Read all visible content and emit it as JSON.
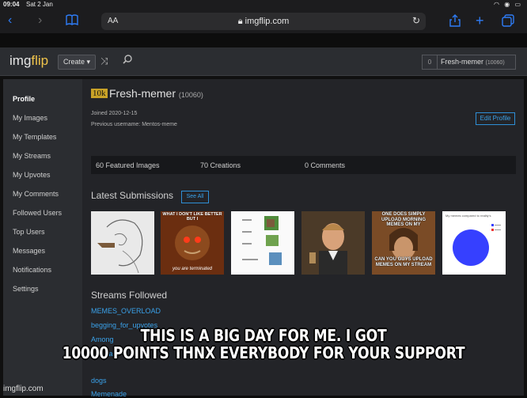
{
  "status_bar": {
    "time": "09:04",
    "date": "Sat 2 Jan",
    "icons": "wifi-icon battery-icon"
  },
  "browser": {
    "text_size_label": "AA",
    "url": "imgflip.com"
  },
  "header": {
    "logo_main": "img",
    "logo_accent": "flip",
    "create_label": "Create ▾",
    "user_points_badge": "0",
    "user_name": "Fresh-memer",
    "user_points": "(10060)"
  },
  "sidebar": {
    "items": [
      {
        "label": "Profile"
      },
      {
        "label": "My Images"
      },
      {
        "label": "My Templates"
      },
      {
        "label": "My Streams"
      },
      {
        "label": "My Upvotes"
      },
      {
        "label": "My Comments"
      },
      {
        "label": "Followed Users"
      },
      {
        "label": "Top Users"
      },
      {
        "label": "Messages"
      },
      {
        "label": "Notifications"
      },
      {
        "label": "Settings"
      }
    ]
  },
  "profile": {
    "rank_badge": "10k",
    "username": "Fresh-memer",
    "points": "(10060)",
    "joined": "Joined 2020-12-15",
    "previous_username": "Previous username: Mentos-meme",
    "edit_label": "Edit Profile",
    "stats": [
      "60 Featured Images",
      "70 Creations",
      "0 Comments"
    ]
  },
  "latest": {
    "title": "Latest Submissions",
    "see_all": "See All",
    "thumbs": [
      {
        "name": "sketch-meme"
      },
      {
        "name": "terminated-meme",
        "top": "WHAT I DON'T LIKE BETTER BUT I",
        "bottom": "you are terminated"
      },
      {
        "name": "minecraft-chart-meme"
      },
      {
        "name": "leo-laughing-meme"
      },
      {
        "name": "one-does-not-simply-meme",
        "top": "ONE DOES SIMPLY UPLOAD MORNING MEMES ON MY",
        "bottom": "CAN YOU GUYS UPLOAD MEMES ON MY STREAM"
      },
      {
        "name": "pie-chart-meme",
        "title": "My memes compared to reality's"
      }
    ]
  },
  "streams": {
    "title": "Streams Followed",
    "items": [
      "MEMES_OVERLOAD",
      "begging_for_upvotes",
      "Among",
      "you-ha",
      "dogs",
      "Memenade"
    ]
  },
  "meme": {
    "caption_line1": "THIS IS A BIG DAY FOR ME. I GOT",
    "caption_line2": "10000 POINTS THNX EVERYBODY FOR YOUR SUPPORT",
    "watermark": "imgflip.com"
  },
  "colors": {
    "accent_blue": "#3aa2ea",
    "logo_yellow": "#f0c44b",
    "pie_blue": "#3640ff"
  }
}
